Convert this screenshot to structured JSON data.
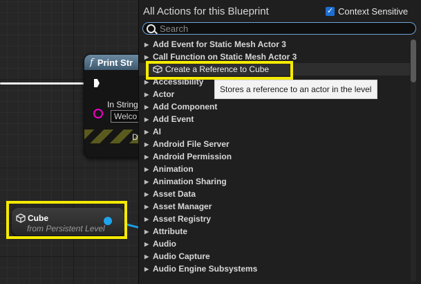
{
  "graph": {
    "print_node": {
      "title": "Print Str",
      "func_icon": "f",
      "in_string_label": "In String",
      "in_string_value": "Welco",
      "dev_label": "D"
    },
    "cube_node": {
      "title": "Cube",
      "subtitle": "from Persistent Level"
    }
  },
  "menu": {
    "title": "All Actions for this Blueprint",
    "context_sensitive": {
      "label": "Context Sensitive",
      "checked": true
    },
    "search_placeholder": "Search",
    "items": [
      {
        "label": "Add Event for Static Mesh Actor 3",
        "expandable": true
      },
      {
        "label": "Call Function on Static Mesh Actor 3",
        "expandable": true
      },
      {
        "label": "Create a Reference to Cube",
        "expandable": false,
        "selected": true
      },
      {
        "label": "Accessibility",
        "expandable": true
      },
      {
        "label": "Actor",
        "expandable": true
      },
      {
        "label": "Add Component",
        "expandable": true
      },
      {
        "label": "Add Event",
        "expandable": true
      },
      {
        "label": "AI",
        "expandable": true
      },
      {
        "label": "Android File Server",
        "expandable": true
      },
      {
        "label": "Android Permission",
        "expandable": true
      },
      {
        "label": "Animation",
        "expandable": true
      },
      {
        "label": "Animation Sharing",
        "expandable": true
      },
      {
        "label": "Asset Data",
        "expandable": true
      },
      {
        "label": "Asset Manager",
        "expandable": true
      },
      {
        "label": "Asset Registry",
        "expandable": true
      },
      {
        "label": "Attribute",
        "expandable": true
      },
      {
        "label": "Audio",
        "expandable": true
      },
      {
        "label": "Audio Capture",
        "expandable": true
      },
      {
        "label": "Audio Engine Subsystems",
        "expandable": true
      }
    ],
    "tooltip": "Stores a reference to an actor in the level"
  },
  "colors": {
    "highlight": "#f5ea00",
    "accent": "#1d6fd3",
    "string_pin": "#f000c8",
    "object_pin": "#1ea4ec"
  }
}
